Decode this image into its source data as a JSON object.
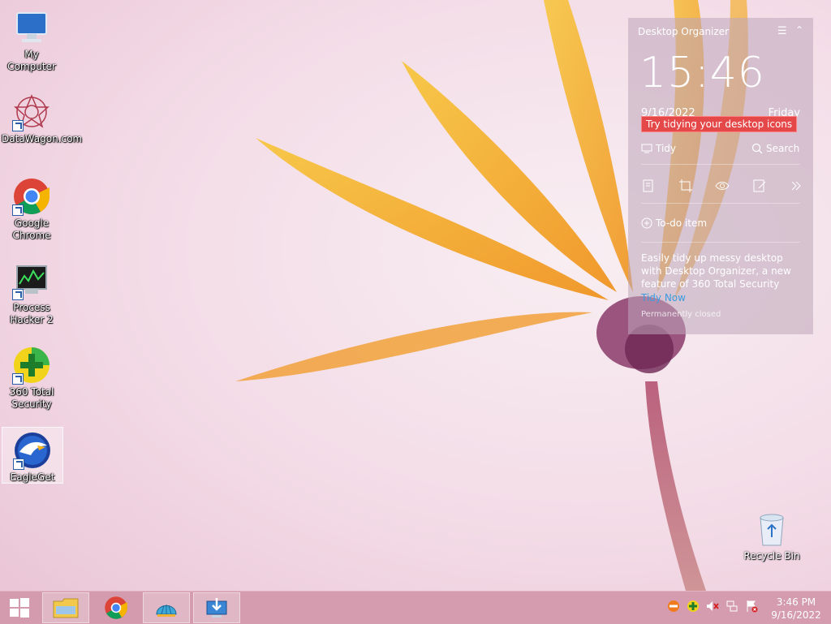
{
  "desktop": {
    "icons": [
      {
        "label": "My Computer"
      },
      {
        "label": "DataWagon.com"
      },
      {
        "label": "Google Chrome"
      },
      {
        "label": "Process Hacker 2"
      },
      {
        "label": "360 Total Security"
      },
      {
        "label": "EagleGet"
      }
    ],
    "recycle_bin": {
      "label": "Recycle Bin"
    }
  },
  "organizer": {
    "title": "Desktop Organizer",
    "time": "15:46",
    "date": "9/16/2022",
    "day": "Friday",
    "tooltip": "Try tidying your desktop icons",
    "tidy_label": "Tidy",
    "search_label": "Search",
    "todo_label": "To-do item",
    "promo_text": "Easily tidy up messy desktop with Desktop Organizer, a new feature of 360 Total Security",
    "tidy_now": "Tidy Now",
    "permanently_closed": "Permanently closed"
  },
  "taskbar": {
    "clock_time": "3:46 PM",
    "clock_date": "9/16/2022"
  },
  "colors": {
    "accent_red": "#e54848",
    "link_blue": "#3b9be0",
    "taskbar": "#d296aa"
  }
}
